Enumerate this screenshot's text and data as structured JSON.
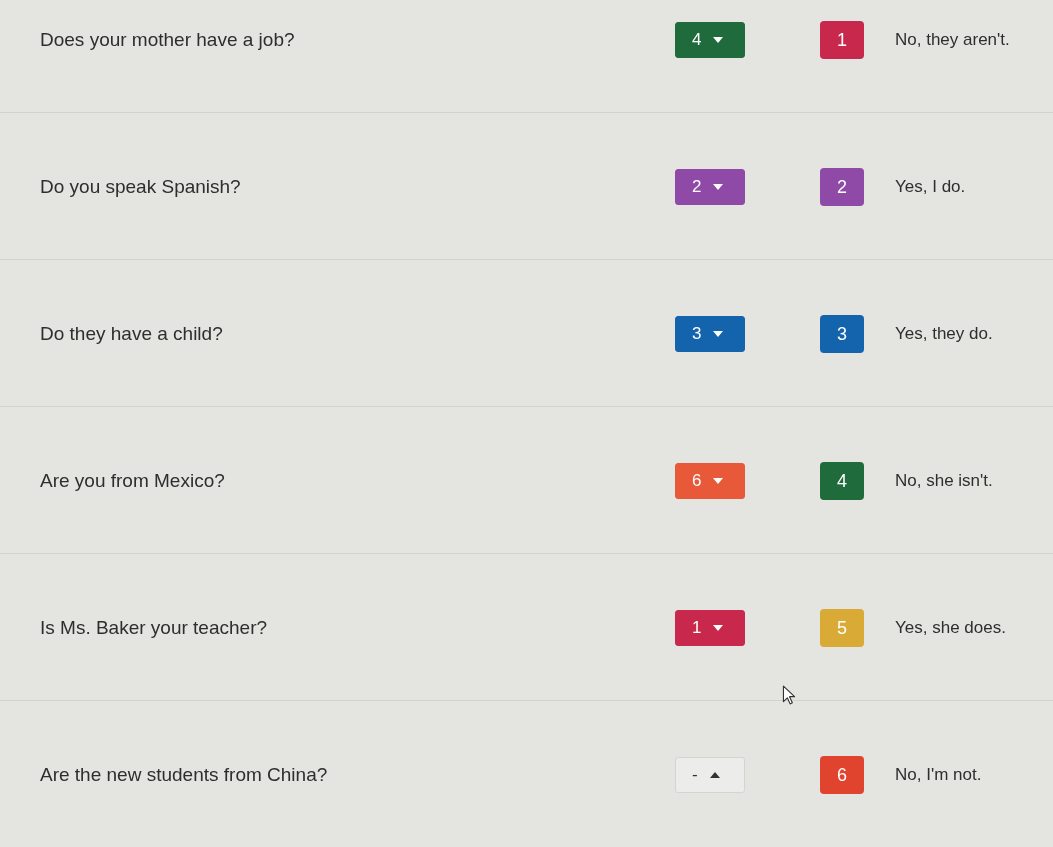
{
  "rows": [
    {
      "question": "Does your mother have a job?",
      "choice": {
        "value": "4",
        "expanded": false,
        "color": "#1f6b3b"
      },
      "answer": {
        "number": "1",
        "color": "#c8284c",
        "text": "No, they aren't."
      }
    },
    {
      "question": "Do you speak Spanish?",
      "choice": {
        "value": "2",
        "expanded": false,
        "color": "#8e4aa6"
      },
      "answer": {
        "number": "2",
        "color": "#8e4aa6",
        "text": "Yes, I do."
      }
    },
    {
      "question": "Do they have a child?",
      "choice": {
        "value": "3",
        "expanded": false,
        "color": "#1463ad"
      },
      "answer": {
        "number": "3",
        "color": "#1463ad",
        "text": "Yes, they do."
      }
    },
    {
      "question": "Are you from Mexico?",
      "choice": {
        "value": "6",
        "expanded": false,
        "color": "#e8593a"
      },
      "answer": {
        "number": "4",
        "color": "#1f6b3b",
        "text": "No, she isn't."
      }
    },
    {
      "question": "Is Ms. Baker your teacher?",
      "choice": {
        "value": "1",
        "expanded": false,
        "color": "#c8284c"
      },
      "answer": {
        "number": "5",
        "color": "#d9aa35",
        "text": "Yes, she does."
      }
    },
    {
      "question": "Are the new students from China?",
      "choice": {
        "value": "-",
        "expanded": true
      },
      "answer": {
        "number": "6",
        "color": "#e0432e",
        "text": "No, I'm not."
      }
    }
  ]
}
